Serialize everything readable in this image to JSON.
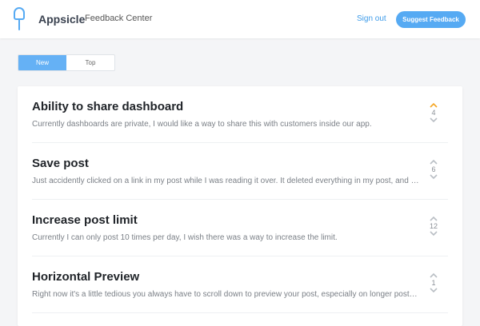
{
  "header": {
    "brand": "Appsicle",
    "subtitle": "Feedback Center",
    "signout_label": "Sign out",
    "suggest_label": "Suggest Feedback",
    "logo_icon": "popsicle-icon"
  },
  "tabs": [
    {
      "label": "New",
      "active": true
    },
    {
      "label": "Top",
      "active": false
    }
  ],
  "posts": [
    {
      "title": "Ability to share dashboard",
      "description": "Currently dashboards are private, I would like a way to share this with customers inside our app.",
      "votes": "4",
      "upvoted": true
    },
    {
      "title": "Save post",
      "description": "Just accidently clicked on a link in my post while I was reading it over. It deleted everything in my post, and I pu...",
      "votes": "6",
      "upvoted": false
    },
    {
      "title": "Increase post limit",
      "description": "Currently I can only post 10 times per day, I wish there was a way to increase the limit.",
      "votes": "12",
      "upvoted": false
    },
    {
      "title": "Horizontal Preview",
      "description": "Right now it's a little tedious you always have to scroll down to preview your post, especially on longer posts,...",
      "votes": "1",
      "upvoted": false
    }
  ],
  "colors": {
    "accent": "#56aaf3",
    "upvote_active": "#f5a623",
    "vote_inactive": "#b9bec4"
  }
}
